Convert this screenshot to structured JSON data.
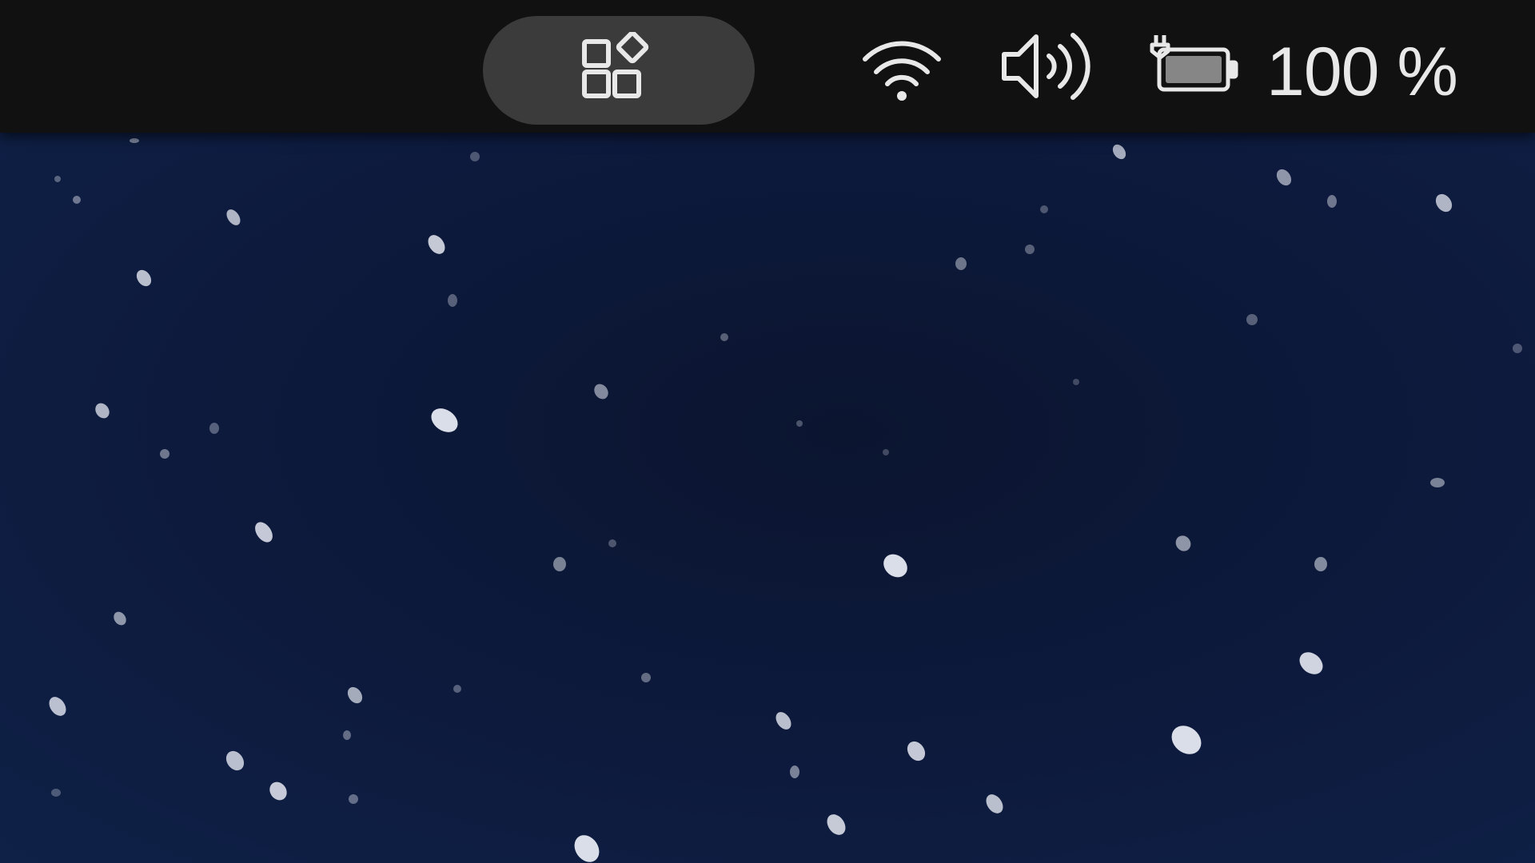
{
  "top_bar": {
    "apps_button_icon": "widgets-icon",
    "tray": {
      "wifi_icon": "wifi-icon",
      "volume_icon": "volume-icon",
      "battery_icon": "battery-charging-icon",
      "battery_percent": "100 %"
    }
  },
  "desktop": {
    "wallpaper": "starry-night-sky"
  },
  "colors": {
    "bar_background": "#111111",
    "pill_background": "#3b3b3b",
    "icon_color": "#e8e8e8",
    "wallpaper_base": "#0d1a3d"
  }
}
